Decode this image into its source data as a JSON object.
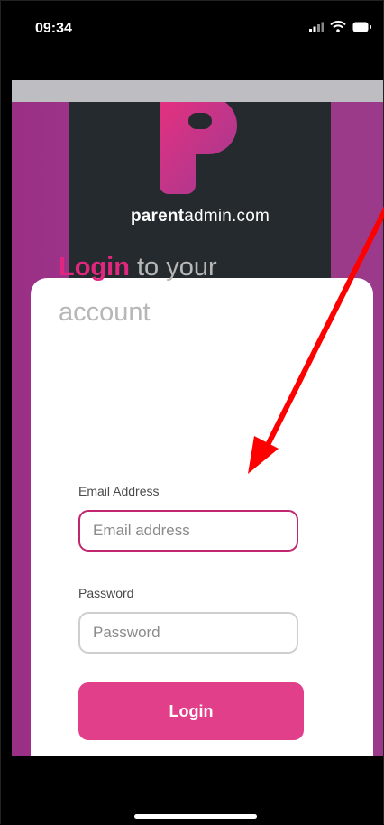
{
  "status_bar": {
    "time": "09:34"
  },
  "brand": {
    "name_bold": "parent",
    "name_regular": "admin.com"
  },
  "login": {
    "heading_accent": "Login",
    "heading_rest": " to your account",
    "email_label": "Email Address",
    "email_placeholder": "Email address",
    "password_label": "Password",
    "password_placeholder": "Password",
    "submit_label": "Login"
  },
  "colors": {
    "accent": "#e0267f",
    "button": "#e23f8a",
    "annotation_arrow": "#ff0000"
  }
}
